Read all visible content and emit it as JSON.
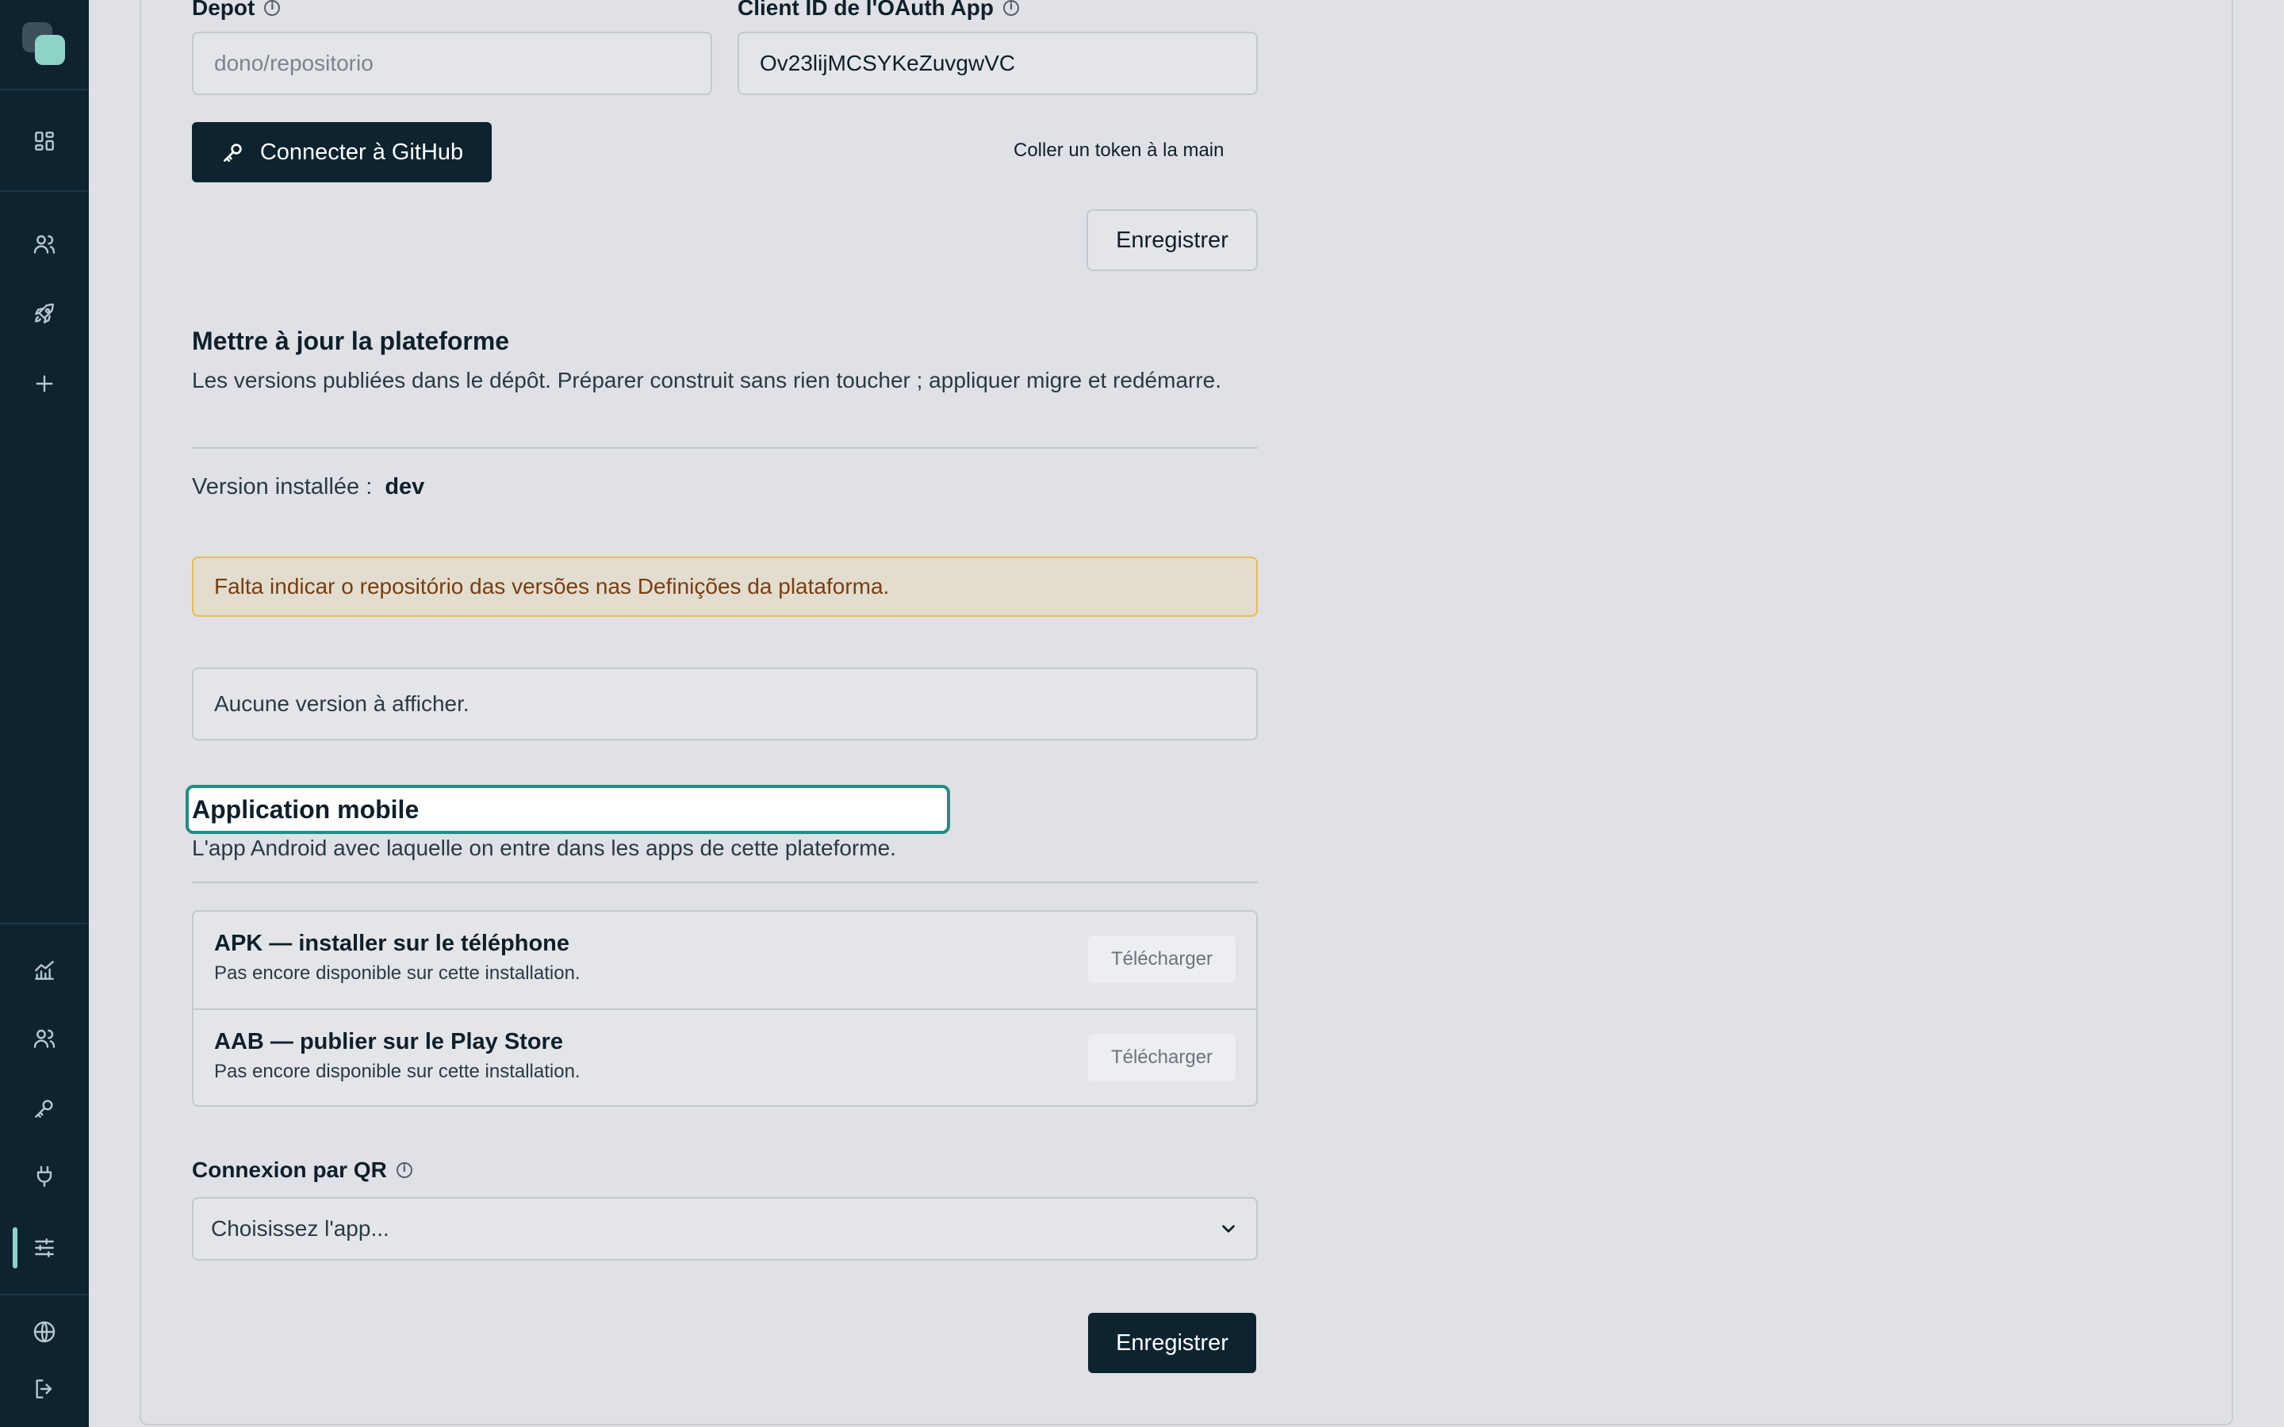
{
  "repo_field": {
    "label": "Depot",
    "placeholder": "dono/repositorio"
  },
  "oauth_field": {
    "label": "Client ID de l'OAuth App",
    "value": "Ov23lijMCSYKeZuvgwVC"
  },
  "github": {
    "connect_label": "Connecter à GitHub",
    "paste_token_label": "Coller un token à la main",
    "save_label": "Enregistrer"
  },
  "update": {
    "title": "Mettre à jour la plateforme",
    "description": "Les versions publiées dans le dépôt. Préparer construit sans rien toucher ; appliquer migre et redémarre.",
    "installed_label": "Version installée :",
    "installed_value": "dev",
    "alert": "Falta indicar o repositório das versões nas Definições da plataforma.",
    "empty": "Aucune version à afficher."
  },
  "mobile": {
    "title": "Application mobile",
    "description": "L'app Android avec laquelle on entre dans les apps de cette plateforme.",
    "items": [
      {
        "title": "APK — installer sur le téléphone",
        "subtitle": "Pas encore disponible sur cette installation.",
        "button": "Télécharger"
      },
      {
        "title": "AAB — publier sur le Play Store",
        "subtitle": "Pas encore disponible sur cette installation.",
        "button": "Télécharger"
      }
    ]
  },
  "qr": {
    "label": "Connexion par QR",
    "selected": "Choisissez l'app..."
  },
  "footer": {
    "save_label": "Enregistrer"
  },
  "colors": {
    "sidebar": "#0d2330",
    "accent": "#8fd3c6",
    "focus": "#1f8f86",
    "alert_border": "#e8bd4a"
  }
}
